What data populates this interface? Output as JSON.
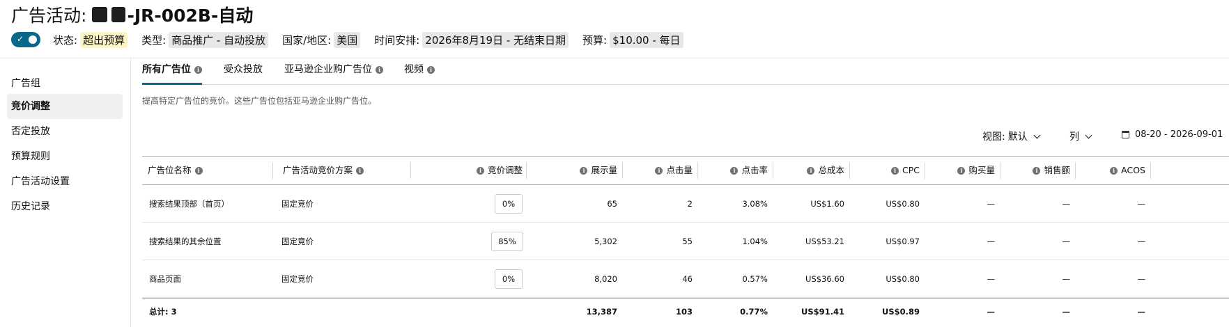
{
  "campaign": {
    "title_prefix": "广告活动: ",
    "title_suffix": "-JR-002B-自动",
    "enabled": true,
    "status_label": "状态:",
    "status_value": "超出预算",
    "type_label": "类型:",
    "type_value": "商品推广 - 自动投放",
    "country_label": "国家/地区:",
    "country_value": "美国",
    "schedule_label": "时间安排:",
    "schedule_value": "2026年8月19日 - 无结束日期",
    "budget_label": "预算:",
    "budget_value": "$10.00 - 每日"
  },
  "sidebar": {
    "items": [
      {
        "label": "广告组",
        "active": false
      },
      {
        "label": "竞价调整",
        "active": true
      },
      {
        "label": "否定投放",
        "active": false
      },
      {
        "label": "预算规则",
        "active": false
      },
      {
        "label": "广告活动设置",
        "active": false
      },
      {
        "label": "历史记录",
        "active": false
      }
    ]
  },
  "tabs": [
    {
      "label": "所有广告位",
      "active": true,
      "info": true
    },
    {
      "label": "受众投放",
      "active": false,
      "info": false
    },
    {
      "label": "亚马逊企业购广告位",
      "active": false,
      "info": true
    },
    {
      "label": "视频",
      "active": false,
      "info": true
    }
  ],
  "description": "提高特定广告位的竞价。这些广告位包括亚马逊企业购广告位。",
  "toolbar": {
    "view_label": "视图:",
    "view_value": "默认",
    "columns_label": "列",
    "date_range": "08-20 - 2026-09-01"
  },
  "table": {
    "headers": {
      "placement": "广告位名称",
      "strategy": "广告活动竞价方案",
      "bid_adjust": "竞价调整",
      "impressions": "展示量",
      "clicks": "点击量",
      "ctr": "点击率",
      "spend": "总成本",
      "cpc": "CPC",
      "orders": "购买量",
      "sales": "销售额",
      "acos": "ACOS"
    },
    "rows": [
      {
        "placement": "搜索结果顶部（首页）",
        "strategy": "固定竞价",
        "bid_adjust": "0%",
        "impressions": "65",
        "clicks": "2",
        "ctr": "3.08%",
        "spend": "US$1.60",
        "cpc": "US$0.80",
        "orders": "—",
        "sales": "—",
        "acos": "—"
      },
      {
        "placement": "搜索结果的其余位置",
        "strategy": "固定竞价",
        "bid_adjust": "85%",
        "impressions": "5,302",
        "clicks": "55",
        "ctr": "1.04%",
        "spend": "US$53.21",
        "cpc": "US$0.97",
        "orders": "—",
        "sales": "—",
        "acos": "—"
      },
      {
        "placement": "商品页面",
        "strategy": "固定竞价",
        "bid_adjust": "0%",
        "impressions": "8,020",
        "clicks": "46",
        "ctr": "0.57%",
        "spend": "US$36.60",
        "cpc": "US$0.80",
        "orders": "—",
        "sales": "—",
        "acos": "—"
      }
    ],
    "total": {
      "placement": "总计: 3",
      "impressions": "13,387",
      "clicks": "103",
      "ctr": "0.77%",
      "spend": "US$91.41",
      "cpc": "US$0.89",
      "orders": "—",
      "sales": "—",
      "acos": "—"
    }
  }
}
